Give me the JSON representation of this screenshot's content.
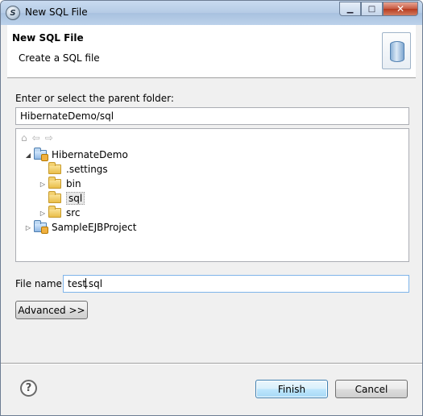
{
  "window": {
    "title": "New SQL File",
    "controls": {
      "minimize": "▁",
      "maximize": "□",
      "close": "✕"
    }
  },
  "banner": {
    "title": "New SQL File",
    "subtitle": "Create a SQL file",
    "icon": "database-wizard-icon"
  },
  "folder": {
    "label": "Enter or select the parent folder:",
    "value": "HibernateDemo/sql"
  },
  "tree": {
    "toolbar": {
      "home": "⌂",
      "back": "⇦",
      "forward": "⇨"
    },
    "items": [
      {
        "label": "HibernateDemo",
        "expander": "◢",
        "kind": "project"
      },
      {
        "label": ".settings",
        "expander": "",
        "kind": "folder"
      },
      {
        "label": "bin",
        "expander": "▷",
        "kind": "folder"
      },
      {
        "label": "sql",
        "expander": "",
        "kind": "folder",
        "selected": true
      },
      {
        "label": "src",
        "expander": "▷",
        "kind": "folder"
      },
      {
        "label": "SampleEJBProject",
        "expander": "▷",
        "kind": "project"
      }
    ]
  },
  "filename": {
    "label": "File name:",
    "value_before_cursor": "test",
    "value_after_cursor": ".sql"
  },
  "buttons": {
    "advanced": "Advanced >>",
    "help": "?",
    "finish": "Finish",
    "cancel": "Cancel"
  }
}
